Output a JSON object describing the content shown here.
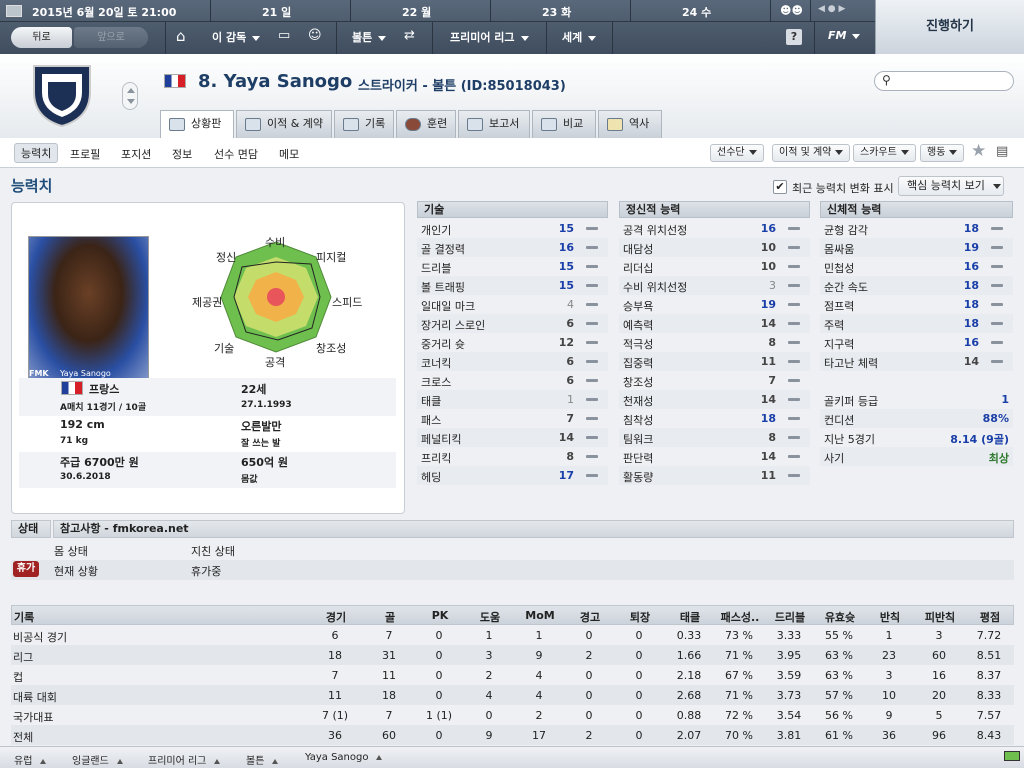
{
  "topbar": {
    "date": "2015년 6월 20일 토 21:00",
    "days": [
      "21 일",
      "22 월",
      "23 화",
      "24 수"
    ],
    "back_label": "뒤로",
    "forward_label": "앞으로",
    "menus": [
      "이 감독",
      "볼튼",
      "프리미어 리그",
      "세계"
    ],
    "help_label": "?",
    "fm_label": "FM",
    "continue_label": "진행하기"
  },
  "player": {
    "number_name": "8. Yaya Sanogo",
    "subtitle": "스트라이커 - 볼튼 (ID:85018043)"
  },
  "tabs": [
    "상황판",
    "이적 & 계약",
    "기록",
    "훈련",
    "보고서",
    "비교",
    "역사"
  ],
  "subnav": {
    "items": [
      "능력치",
      "프로필",
      "포지션",
      "정보",
      "선수 면담",
      "메모"
    ],
    "dropdowns": [
      "선수단",
      "이적 및 계약",
      "스카우트",
      "행동"
    ]
  },
  "section": {
    "title": "능력치",
    "recent_change_label": "최근 능력치 변화 표시",
    "key_attr_label": "핵심 능력치 보기"
  },
  "photo_caption": "Yaya Sanogo",
  "photo_tag": "FMK",
  "radar_labels": [
    "수비",
    "피지컬",
    "스피드",
    "창조성",
    "공격",
    "기술",
    "제공권",
    "정신"
  ],
  "profile": {
    "nation": "프랑스",
    "caps": "A매치 11경기 / 10골",
    "age": "22세",
    "dob": "27.1.1993",
    "height": "192 cm",
    "weight": "71 kg",
    "foot": "오른발만",
    "weak_foot": "잘 쓰는 발",
    "wage": "주급 6700만 원",
    "contract": "30.6.2018",
    "value": "650억 원",
    "value_label": "몸값"
  },
  "technical": {
    "title": "기술",
    "rows": [
      {
        "name": "개인기",
        "value": "15"
      },
      {
        "name": "골 결정력",
        "value": "16"
      },
      {
        "name": "드리블",
        "value": "15"
      },
      {
        "name": "볼 트래핑",
        "value": "15"
      },
      {
        "name": "일대일 마크",
        "value": "4"
      },
      {
        "name": "장거리 스로인",
        "value": "6"
      },
      {
        "name": "중거리 슛",
        "value": "12"
      },
      {
        "name": "코너킥",
        "value": "6"
      },
      {
        "name": "크로스",
        "value": "6"
      },
      {
        "name": "태클",
        "value": "1"
      },
      {
        "name": "패스",
        "value": "7"
      },
      {
        "name": "페널티킥",
        "value": "14"
      },
      {
        "name": "프리킥",
        "value": "8"
      },
      {
        "name": "헤딩",
        "value": "17"
      }
    ]
  },
  "mental": {
    "title": "정신적 능력",
    "rows": [
      {
        "name": "공격 위치선정",
        "value": "16"
      },
      {
        "name": "대담성",
        "value": "10"
      },
      {
        "name": "리더십",
        "value": "10"
      },
      {
        "name": "수비 위치선정",
        "value": "3"
      },
      {
        "name": "승부욕",
        "value": "19"
      },
      {
        "name": "예측력",
        "value": "14"
      },
      {
        "name": "적극성",
        "value": "8"
      },
      {
        "name": "집중력",
        "value": "11"
      },
      {
        "name": "창조성",
        "value": "7"
      },
      {
        "name": "천재성",
        "value": "14"
      },
      {
        "name": "침착성",
        "value": "18"
      },
      {
        "name": "팀워크",
        "value": "8"
      },
      {
        "name": "판단력",
        "value": "14"
      },
      {
        "name": "활동량",
        "value": "11"
      }
    ]
  },
  "physical": {
    "title": "신체적 능력",
    "rows": [
      {
        "name": "균형 감각",
        "value": "18"
      },
      {
        "name": "몸싸움",
        "value": "19"
      },
      {
        "name": "민첩성",
        "value": "16"
      },
      {
        "name": "순간 속도",
        "value": "18"
      },
      {
        "name": "점프력",
        "value": "18"
      },
      {
        "name": "주력",
        "value": "18"
      },
      {
        "name": "지구력",
        "value": "16"
      },
      {
        "name": "타고난 체력",
        "value": "14"
      }
    ],
    "extra": [
      {
        "name": "골키퍼 등급",
        "value": "1"
      },
      {
        "name": "컨디션",
        "value": "88%"
      },
      {
        "name": "지난 5경기",
        "value": "8.14 (9골)"
      },
      {
        "name": "사기",
        "value": "최상"
      }
    ]
  },
  "status": {
    "header": "상태",
    "note": "참고사항 - fmkorea.net",
    "body_label": "몸 상태",
    "body_value": "지친 상태",
    "holiday_badge": "휴가",
    "current_label": "현재 상황",
    "current_value": "휴가중"
  },
  "stats": {
    "headers": [
      "기록",
      "경기",
      "골",
      "PK",
      "도움",
      "MoM",
      "경고",
      "퇴장",
      "태클",
      "패스성..",
      "드리블",
      "유효슛",
      "반칙",
      "피반칙",
      "평점"
    ],
    "rows": [
      [
        "비공식 경기",
        "6",
        "7",
        "0",
        "1",
        "1",
        "0",
        "0",
        "0.33",
        "73 %",
        "3.33",
        "55 %",
        "1",
        "3",
        "7.72"
      ],
      [
        "리그",
        "18",
        "31",
        "0",
        "3",
        "9",
        "2",
        "0",
        "1.66",
        "71 %",
        "3.95",
        "63 %",
        "23",
        "60",
        "8.51"
      ],
      [
        "컵",
        "7",
        "11",
        "0",
        "2",
        "4",
        "0",
        "0",
        "2.18",
        "67 %",
        "3.59",
        "63 %",
        "3",
        "16",
        "8.37"
      ],
      [
        "대륙 대회",
        "11",
        "18",
        "0",
        "4",
        "4",
        "0",
        "0",
        "2.68",
        "71 %",
        "3.73",
        "57 %",
        "10",
        "20",
        "8.33"
      ],
      [
        "국가대표",
        "7 (1)",
        "7",
        "1 (1)",
        "0",
        "2",
        "0",
        "0",
        "0.88",
        "72 %",
        "3.54",
        "56 %",
        "9",
        "5",
        "7.57"
      ],
      [
        "전체",
        "36",
        "60",
        "0",
        "9",
        "17",
        "2",
        "0",
        "2.07",
        "70 %",
        "3.81",
        "61 %",
        "36",
        "96",
        "8.43"
      ]
    ]
  },
  "breadcrumb": [
    "유럽",
    "잉글랜드",
    "프리미어 리그",
    "볼튼",
    "Yaya Sanogo"
  ]
}
